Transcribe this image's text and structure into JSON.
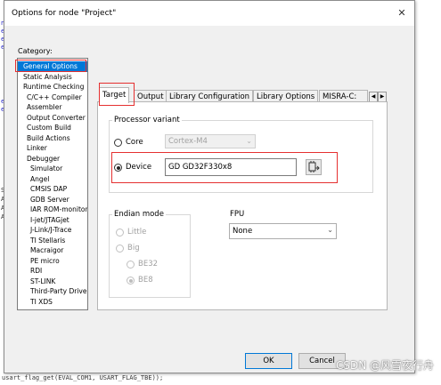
{
  "dialog": {
    "title": "Options for node \"Project\"",
    "close_glyph": "✕"
  },
  "category": {
    "label": "Category:",
    "items": [
      {
        "label": "General Options",
        "selected": true
      },
      {
        "label": "Static Analysis"
      },
      {
        "label": "Runtime Checking"
      },
      {
        "label": "C/C++ Compiler"
      },
      {
        "label": "Assembler"
      },
      {
        "label": "Output Converter"
      },
      {
        "label": "Custom Build"
      },
      {
        "label": "Build Actions"
      },
      {
        "label": "Linker"
      },
      {
        "label": "Debugger"
      },
      {
        "label": "Simulator"
      },
      {
        "label": "Angel"
      },
      {
        "label": "CMSIS DAP"
      },
      {
        "label": "GDB Server"
      },
      {
        "label": "IAR ROM-monitor"
      },
      {
        "label": "I-jet/JTAGjet"
      },
      {
        "label": "J-Link/J-Trace"
      },
      {
        "label": "TI Stellaris"
      },
      {
        "label": "Macraigor"
      },
      {
        "label": "PE micro"
      },
      {
        "label": "RDI"
      },
      {
        "label": "ST-LINK"
      },
      {
        "label": "Third-Party Driver"
      },
      {
        "label": "TI XDS"
      }
    ]
  },
  "tabs": [
    {
      "label": "Target",
      "active": true
    },
    {
      "label": "Output"
    },
    {
      "label": "Library Configuration"
    },
    {
      "label": "Library Options"
    },
    {
      "label": "MISRA-C:"
    }
  ],
  "processor": {
    "legend": "Processor variant",
    "core_label": "Core",
    "core_value": "Cortex-M4",
    "device_label": "Device",
    "device_value": "GD GD32F330x8"
  },
  "endian": {
    "legend": "Endian mode",
    "little": "Little",
    "big": "Big",
    "be32": "BE32",
    "be8": "BE8"
  },
  "fpu": {
    "label": "FPU",
    "value": "None"
  },
  "buttons": {
    "ok": "OK",
    "cancel": "Cancel"
  },
  "background_code": "usart_flag_get(EVAL_COM1, USART_FLAG_TBE));",
  "watermark": "CSDN @风雪夜行舟",
  "colors": {
    "selection": "#0078d7",
    "highlight_box": "#e53030"
  }
}
